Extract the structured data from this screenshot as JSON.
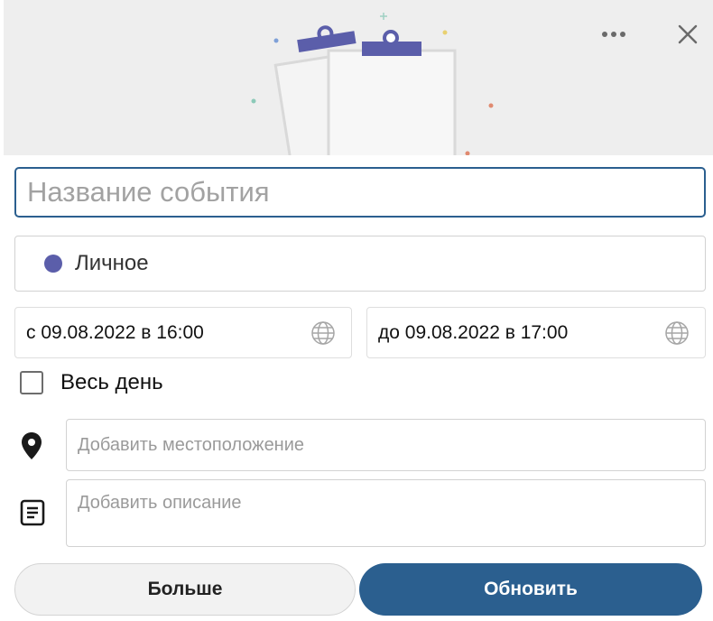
{
  "header": {
    "more_icon": "more-horizontal-icon",
    "close_icon": "close-icon"
  },
  "form": {
    "title_placeholder": "Название события",
    "title_value": "",
    "calendar": {
      "label": "Личное",
      "color": "#5b5eaa"
    },
    "start": {
      "text": "с 09.08.2022 в 16:00",
      "icon": "globe-icon"
    },
    "end": {
      "text": "до 09.08.2022 в 17:00",
      "icon": "globe-icon"
    },
    "all_day": {
      "label": "Весь день",
      "checked": false
    },
    "location": {
      "placeholder": "Добавить местоположение",
      "icon": "location-pin-icon"
    },
    "description": {
      "placeholder": "Добавить описание",
      "icon": "notes-icon"
    }
  },
  "buttons": {
    "more_label": "Больше",
    "update_label": "Обновить"
  },
  "colors": {
    "accent": "#2b5f8f",
    "calendar_dot": "#5b5eaa",
    "header_bg": "#eeeeee"
  }
}
